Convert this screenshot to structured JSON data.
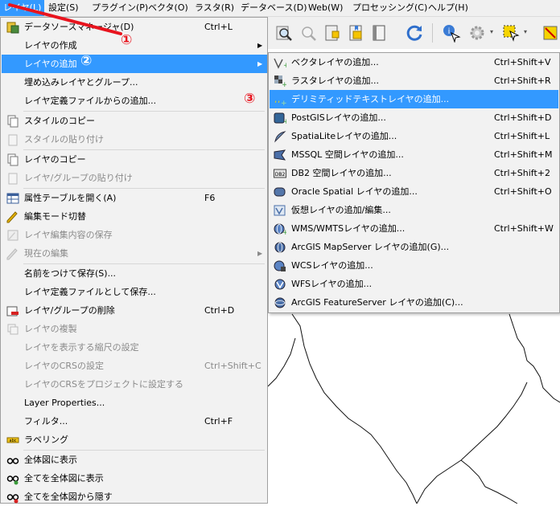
{
  "menubar": {
    "items": [
      {
        "label": "レイヤ(L)"
      },
      {
        "label": "設定(S)"
      },
      {
        "label": "プラグイン(P)"
      },
      {
        "label": "ベクタ(O)"
      },
      {
        "label": "ラスタ(R)"
      },
      {
        "label": "データベース(D)"
      },
      {
        "label": "Web(W)"
      },
      {
        "label": "プロセッシング(C)"
      },
      {
        "label": "ヘルプ(H)"
      }
    ]
  },
  "layer_menu": {
    "items": [
      {
        "label": "データソースマネージャ(D)",
        "shortcut": "Ctrl+L"
      },
      {
        "label": "レイヤの作成"
      },
      {
        "label": "レイヤの追加"
      },
      {
        "label": "埋め込みレイヤとグループ..."
      },
      {
        "label": "レイヤ定義ファイルからの追加..."
      },
      {
        "label": "スタイルのコピー"
      },
      {
        "label": "スタイルの貼り付け"
      },
      {
        "label": "レイヤのコピー"
      },
      {
        "label": "レイヤ/グループの貼り付け"
      },
      {
        "label": "属性テーブルを開く(A)",
        "shortcut": "F6"
      },
      {
        "label": "編集モード切替"
      },
      {
        "label": "レイヤ編集内容の保存"
      },
      {
        "label": "現在の編集"
      },
      {
        "label": "名前をつけて保存(S)..."
      },
      {
        "label": "レイヤ定義ファイルとして保存..."
      },
      {
        "label": "レイヤ/グループの削除",
        "shortcut": "Ctrl+D"
      },
      {
        "label": "レイヤの複製"
      },
      {
        "label": "レイヤを表示する縮尺の設定"
      },
      {
        "label": "レイヤのCRSの設定",
        "shortcut": "Ctrl+Shift+C"
      },
      {
        "label": "レイヤのCRSをプロジェクトに設定する"
      },
      {
        "label": "Layer Properties..."
      },
      {
        "label": "フィルタ...",
        "shortcut": "Ctrl+F"
      },
      {
        "label": "ラベリング"
      },
      {
        "label": "全体図に表示"
      },
      {
        "label": "全てを全体図に表示"
      },
      {
        "label": "全てを全体図から隠す"
      }
    ]
  },
  "add_layer_submenu": {
    "items": [
      {
        "label": "ベクタレイヤの追加...",
        "shortcut": "Ctrl+Shift+V"
      },
      {
        "label": "ラスタレイヤの追加...",
        "shortcut": "Ctrl+Shift+R"
      },
      {
        "label": "デリミティッドテキストレイヤの追加..."
      },
      {
        "label": "PostGISレイヤの追加...",
        "shortcut": "Ctrl+Shift+D"
      },
      {
        "label": "SpatiaLiteレイヤの追加...",
        "shortcut": "Ctrl+Shift+L"
      },
      {
        "label": "MSSQL 空間レイヤの追加...",
        "shortcut": "Ctrl+Shift+M"
      },
      {
        "label": "DB2 空間レイヤの追加...",
        "shortcut": "Ctrl+Shift+2"
      },
      {
        "label": "Oracle Spatial レイヤの追加...",
        "shortcut": "Ctrl+Shift+O"
      },
      {
        "label": "仮想レイヤの追加/編集..."
      },
      {
        "label": "WMS/WMTSレイヤの追加...",
        "shortcut": "Ctrl+Shift+W"
      },
      {
        "label": "ArcGIS MapServer レイヤの追加(G)..."
      },
      {
        "label": "WCSレイヤの追加..."
      },
      {
        "label": "WFSレイヤの追加..."
      },
      {
        "label": "ArcGIS FeatureServer レイヤの追加(C)..."
      }
    ]
  },
  "annotations": {
    "step1": "①",
    "step2": "②",
    "step3": "③"
  },
  "colors": {
    "highlight": "#3399ff",
    "annotation": "#e8141e",
    "menu_bg": "#f2f2f2"
  }
}
